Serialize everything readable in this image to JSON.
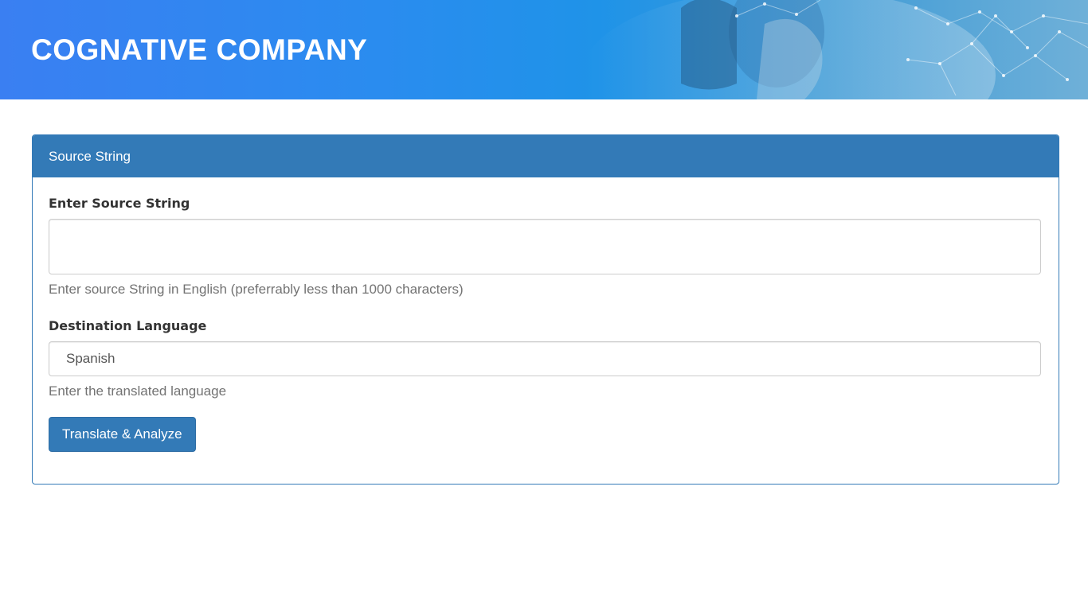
{
  "header": {
    "company_name": "COGNATIVE COMPANY"
  },
  "panel": {
    "heading": "Source String",
    "source_field": {
      "label": "Enter Source String",
      "value": "",
      "help": "Enter source String in English (preferrably less than 1000 characters)"
    },
    "language_field": {
      "label": "Destination Language",
      "selected": "Spanish",
      "help": "Enter the translated language"
    },
    "submit_label": "Translate & Analyze"
  },
  "colors": {
    "primary": "#337ab7",
    "banner_start": "#3a7ff2",
    "banner_end": "#6fb0d8"
  }
}
